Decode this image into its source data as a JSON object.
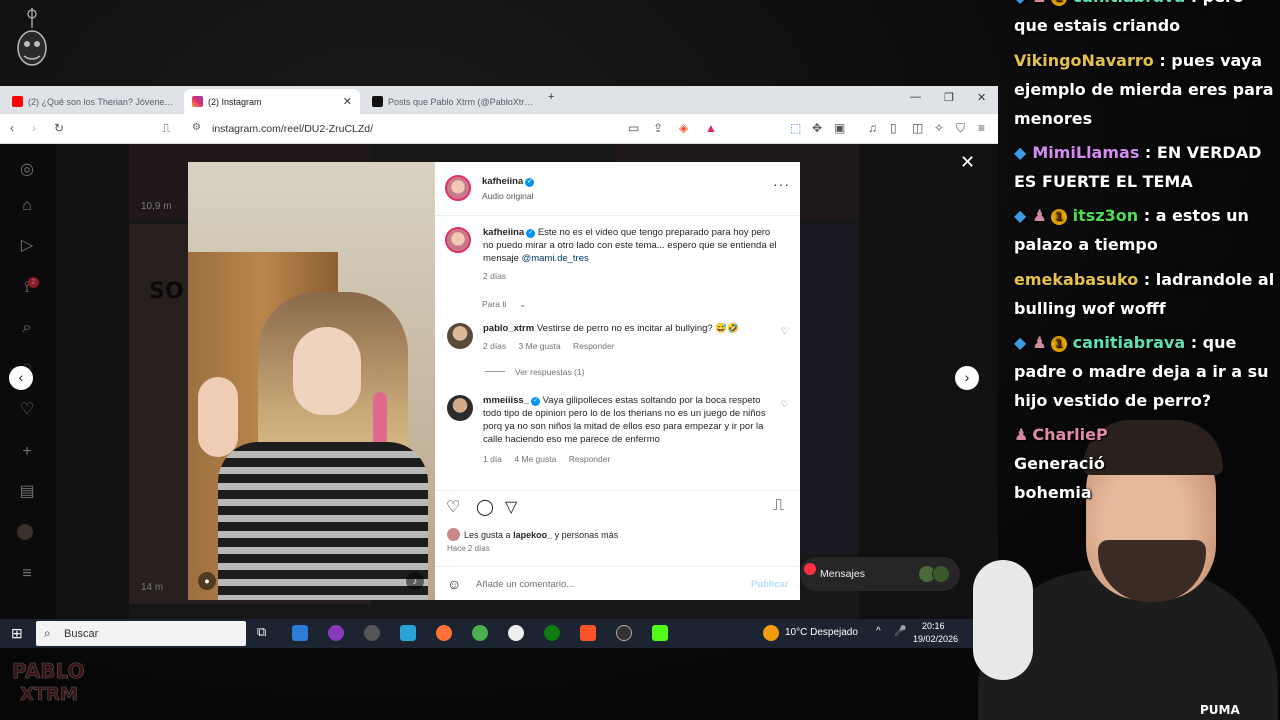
{
  "browser": {
    "tabs": [
      {
        "title": "(2) ¿Qué son los Therian? Jóvenes que",
        "icon": "youtube-icon",
        "color": "#ff0000"
      },
      {
        "title": "(2) Instagram",
        "icon": "instagram-icon",
        "color": "#e1306c"
      },
      {
        "title": "Posts que Pablo Xtrm (@PabloXtrm) · X",
        "icon": "x-icon",
        "color": "#000000"
      }
    ],
    "url": "instagram.com/reel/DU2-ZruCLZd/"
  },
  "instagram": {
    "sidebar_badge": "2",
    "background_tiles": {
      "views_top": "10,9 m",
      "views_bottom": "14 m",
      "tile_text": "SO"
    },
    "post": {
      "author": "kafheiina",
      "audio": "Audio original",
      "caption": "Este no es el video que tengo preparado para hoy pero no puedo mirar a otro lado con este tema... espero que se entienda el mensaje",
      "caption_mention": "@mami.de_tres",
      "caption_time": "2 días",
      "for_you": "Para ti",
      "comments": [
        {
          "user": "pablo_xtrm",
          "text": "Vestirse de perro no es incitar al bullying? 😅🤣",
          "time": "2 días",
          "likes": "3 Me gusta",
          "reply": "Responder",
          "view_replies": "Ver respuestas (1)"
        },
        {
          "user": "mmeiiiss_",
          "text": "Vaya gilipolleces estas soltando por la boca respeto todo tipo de opinion pero lo de los therians no es un juego de niños porq ya no son niños la mitad de ellos eso para empezar y ir por la calle haciendo eso me parece de enfermo",
          "time": "1 día",
          "likes": "4 Me gusta",
          "reply": "Responder"
        }
      ],
      "liked_by_prefix": "Les gusta a",
      "liked_by_user": "lapekoo_",
      "liked_by_suffix": "y personas más",
      "posted_ago": "Hace 2 días",
      "add_comment_placeholder": "Añade un comentario...",
      "publish": "Publicar"
    },
    "messages_label": "Mensajes"
  },
  "taskbar": {
    "search": "Buscar",
    "weather": "10°C  Despejado",
    "time": "20:16",
    "date": "19/02/2026"
  },
  "chat": {
    "messages": [
      {
        "user": "canitiabrava",
        "user_color": "#5fe0b0",
        "text": ": pero que estais criando",
        "badges": [
          "cube",
          "b",
          "1"
        ]
      },
      {
        "user": "VikingoNavarro",
        "user_color": "#e6c14a",
        "text": ": pues vaya ejemplo de mierda eres para menores",
        "badges": []
      },
      {
        "user": "MimiLlamas",
        "user_color": "#d58cf2",
        "text": ": EN VERDAD ES FUERTE EL TEMA",
        "badges": [
          "cube"
        ]
      },
      {
        "user": "itsz3on",
        "user_color": "#4fdd4f",
        "text": ": a estos un palazo a tiempo",
        "badges": [
          "cube",
          "b",
          "1"
        ]
      },
      {
        "user": "emekabasuko",
        "user_color": "#e6c14a",
        "text": ": ladrandole al bulling wof wofff",
        "badges": []
      },
      {
        "user": "canitiabrava",
        "user_color": "#5fe0b0",
        "text": ": que padre o madre deja a ir a su hijo vestido de perro?",
        "badges": [
          "cube",
          "b",
          "1"
        ]
      },
      {
        "user": "CharlieP",
        "user_color": "#e38aa6",
        "text": "Generació bohemia",
        "badges": [
          "b"
        ]
      }
    ]
  },
  "webcam": {
    "shirt_brand": "PUMA"
  }
}
